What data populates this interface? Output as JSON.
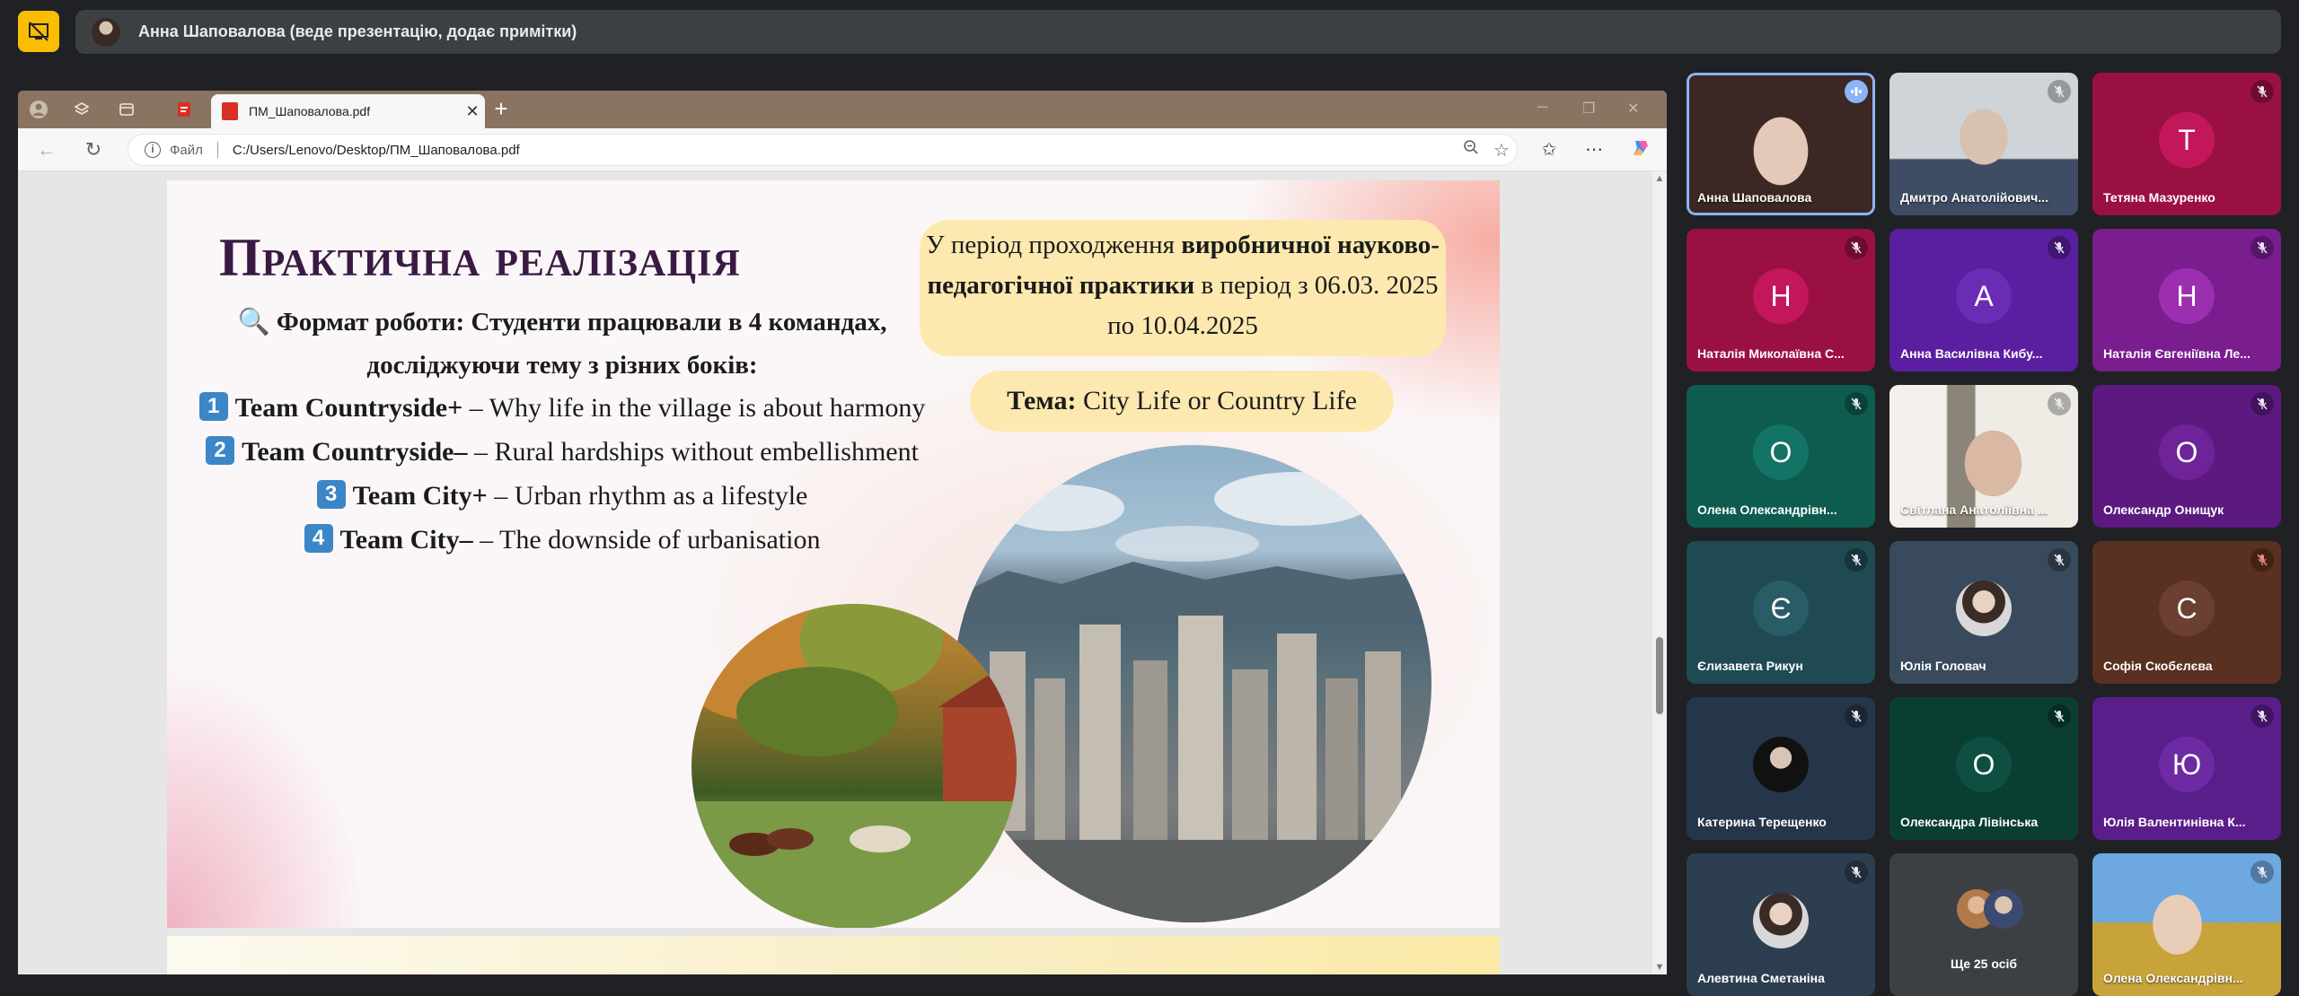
{
  "meet": {
    "presenter_bar": "Анна Шаповалова (веде презентацію, додає примітки)",
    "accent_color": "#fbbc04"
  },
  "browser": {
    "tab_title": "ПМ_Шаповалова.pdf",
    "address_label": "Файл",
    "address_url": "C:/Users/Lenovo/Desktop/ПМ_Шаповалова.pdf"
  },
  "slide": {
    "title": "Практична реалізація",
    "format_line1": "🔍 Формат роботи: Студенти працювали в 4 командах,",
    "format_line2": "досліджуючи тему з різних боків:",
    "teams": [
      {
        "num": "1",
        "name": "Team Countryside+",
        "desc": " – Why life in the village is about harmony"
      },
      {
        "num": "2",
        "name": "Team Countryside–",
        "desc": " – Rural hardships without embellishment"
      },
      {
        "num": "3",
        "name": "Team City+",
        "desc": " – Urban rhythm as a lifestyle"
      },
      {
        "num": "4",
        "name": "Team City–",
        "desc": " – The downside of urbanisation"
      }
    ],
    "period_pre": "У період проходження ",
    "period_bold": "виробничної науково-педагогічної практики",
    "period_post": " в період з 06.03. 2025 по 10.04.2025",
    "topic_label": "Тема:",
    "topic_value": " City Life or Country Life"
  },
  "participants": [
    {
      "name": "Анна Шаповалова",
      "kind": "video-woman",
      "active": true,
      "mic": "speaking"
    },
    {
      "name": "Дмитро Анатолійович...",
      "kind": "video-man",
      "mic": "muted"
    },
    {
      "name": "Тетяна Мазуренко",
      "initial": "Т",
      "bg": "#9b1043",
      "av": "#c2185b",
      "mic": "muted"
    },
    {
      "name": "Наталія Миколаївна С...",
      "initial": "Н",
      "bg": "#9b1043",
      "av": "#c2185b",
      "mic": "muted"
    },
    {
      "name": "Анна Василівна Кибу...",
      "initial": "А",
      "bg": "#5a1ea0",
      "av": "#6a2bb5",
      "mic": "muted"
    },
    {
      "name": "Наталія Євгеніївна Ле...",
      "initial": "Н",
      "bg": "#7a1d8f",
      "av": "#9c2fb0",
      "mic": "muted"
    },
    {
      "name": "Олена Олександрівн...",
      "initial": "О",
      "bg": "#0e5c50",
      "av": "#137364",
      "mic": "muted"
    },
    {
      "name": "Світлана Анатоліївна ...",
      "kind": "video-office",
      "mic": "muted"
    },
    {
      "name": "Олександр Онищук",
      "initial": "О",
      "bg": "#5c1a80",
      "av": "#6f2399",
      "mic": "muted"
    },
    {
      "name": "Єлизавета Рикун",
      "initial": "Є",
      "bg": "#1f4a52",
      "av": "#285c66",
      "mic": "muted"
    },
    {
      "name": "Юлія Головач",
      "kind": "photo",
      "bg": "#384a5c",
      "mic": "muted"
    },
    {
      "name": "Софія Скобєлєва",
      "initial": "С",
      "bg": "#5a3020",
      "av": "#6b4030",
      "mic": "muted-red"
    },
    {
      "name": "Катерина Терещенко",
      "kind": "photo-dark",
      "bg": "#26364a",
      "mic": "muted"
    },
    {
      "name": "Олександра Лівінська",
      "initial": "О",
      "bg": "#0b3e33",
      "av": "#0f4f42",
      "mic": "muted"
    },
    {
      "name": "Юлія Валентинівна К...",
      "initial": "Ю",
      "bg": "#5a1e8a",
      "av": "#6d2aa3",
      "mic": "muted"
    },
    {
      "name": "Алевтина Сметаніна",
      "kind": "photo",
      "bg": "#2c3e50",
      "mic": "muted"
    },
    {
      "name": "Ще 25 осіб",
      "kind": "more",
      "bg": "#3c4043"
    },
    {
      "name": "Олена Олександрівн...",
      "kind": "video-field",
      "mic": "muted"
    }
  ]
}
